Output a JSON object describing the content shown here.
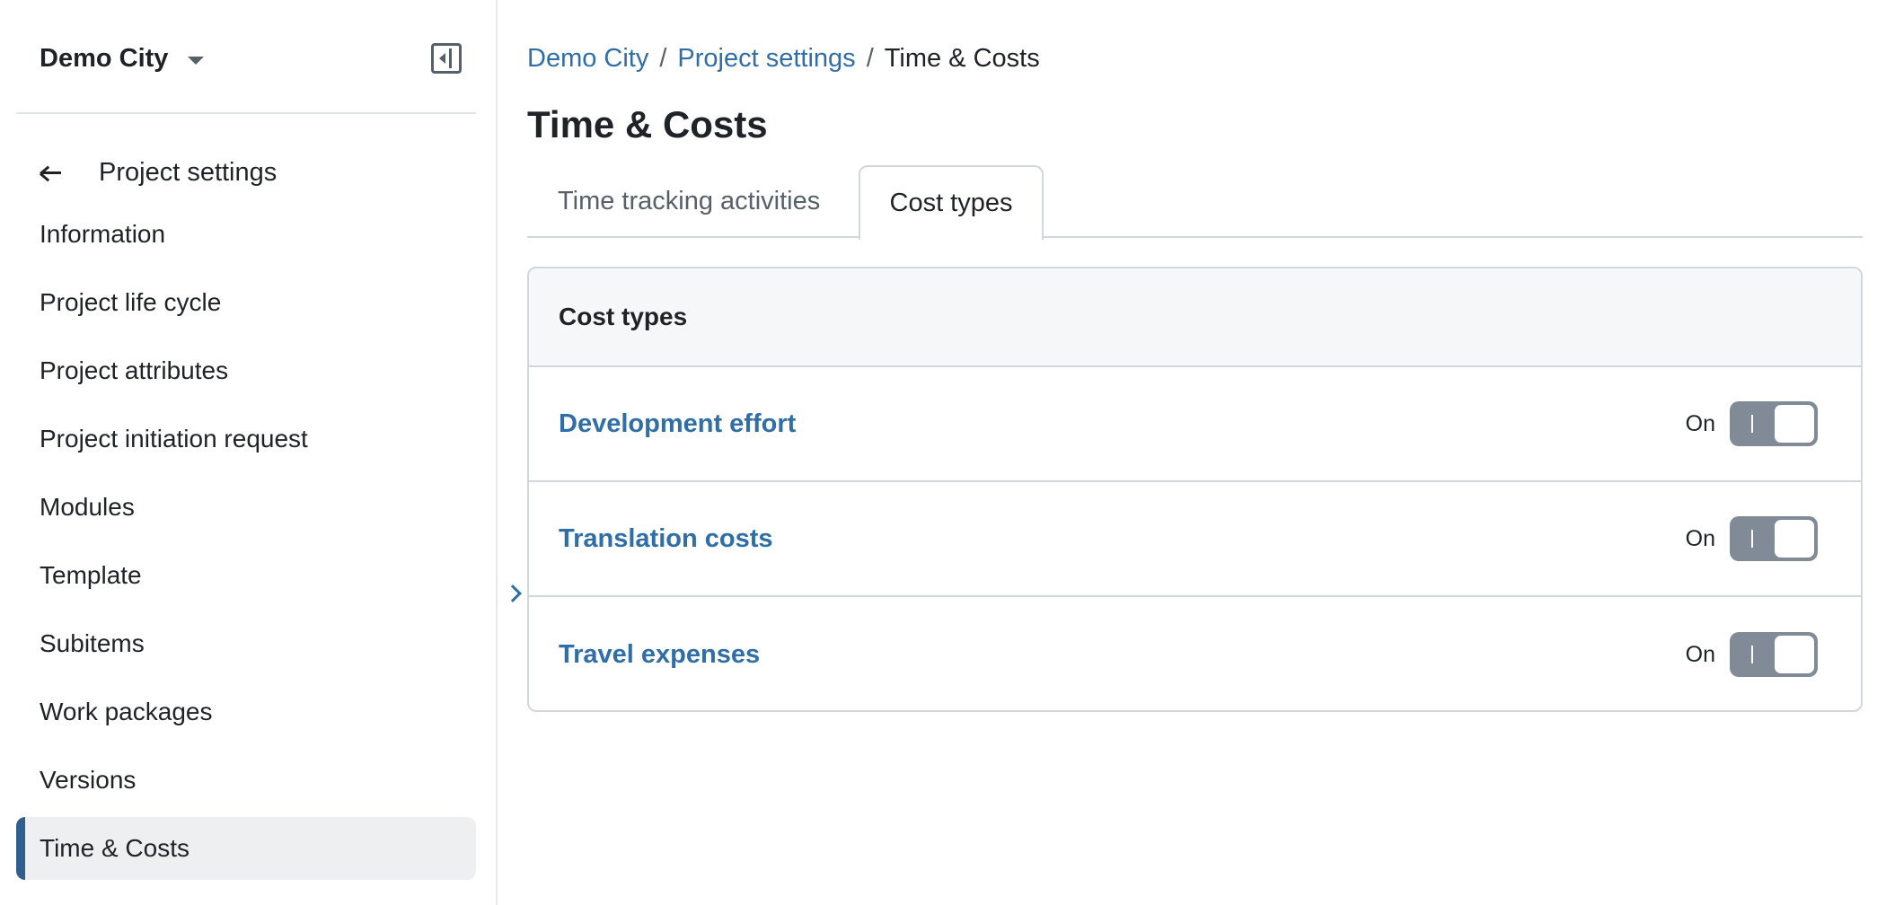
{
  "sidebar": {
    "project_name": "Demo City",
    "back_label": "Project settings",
    "items": [
      {
        "label": "Information"
      },
      {
        "label": "Project life cycle"
      },
      {
        "label": "Project attributes"
      },
      {
        "label": "Project initiation request"
      },
      {
        "label": "Modules"
      },
      {
        "label": "Template"
      },
      {
        "label": "Subitems"
      },
      {
        "label": "Work packages"
      },
      {
        "label": "Versions"
      },
      {
        "label": "Time & Costs",
        "active": true
      }
    ]
  },
  "breadcrumb": {
    "items": [
      "Demo City",
      "Project settings",
      "Time & Costs"
    ],
    "separator": "/"
  },
  "page": {
    "title": "Time & Costs"
  },
  "tabs": [
    {
      "label": "Time tracking activities",
      "selected": false
    },
    {
      "label": "Cost types",
      "selected": true
    }
  ],
  "panel": {
    "heading": "Cost types",
    "rows": [
      {
        "name": "Development effort",
        "status": "On",
        "enabled": true
      },
      {
        "name": "Translation costs",
        "status": "On",
        "enabled": true
      },
      {
        "name": "Travel expenses",
        "status": "On",
        "enabled": true
      }
    ]
  },
  "colors": {
    "link": "#2f6ea8",
    "active_indicator": "#2f5f8f",
    "toggle_on": "#818b98"
  },
  "icons": {
    "project_dropdown": "chevron-down-icon",
    "collapse_sidebar": "sidebar-collapse-icon",
    "back": "arrow-left-icon",
    "expand_sidebar": "chevron-right-icon"
  }
}
